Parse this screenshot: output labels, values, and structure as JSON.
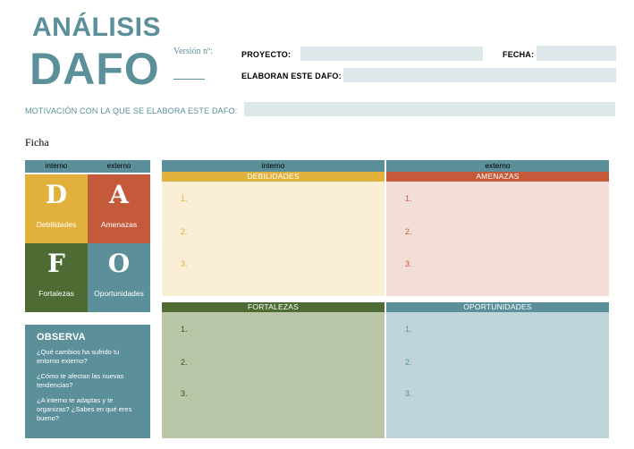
{
  "header": {
    "title_line1": "ANÁLISIS",
    "title_line2": "DAFO",
    "version_label": "Versión nº:"
  },
  "fields": {
    "proyecto_label": "PROYECTO:",
    "fecha_label": "FECHA:",
    "elaboran_label": "ELABORAN ESTE DAFO:",
    "motivacion_label": "MOTIVACIÓN CON LA QUE SE ELABORA ESTE DAFO:"
  },
  "ficha_label": "Ficha",
  "legend": {
    "col_interno": "interno",
    "col_externo": "externo",
    "cells": [
      {
        "letter": "D",
        "name": "Debilidades",
        "color": "#e2b13c"
      },
      {
        "letter": "A",
        "name": "Amenazas",
        "color": "#c55a3b"
      },
      {
        "letter": "F",
        "name": "Fortalezas",
        "color": "#4f6b34"
      },
      {
        "letter": "O",
        "name": "Oportunidades",
        "color": "#5b8f9a"
      }
    ]
  },
  "observa": {
    "title": "OBSERVA",
    "questions": [
      "¿Qué cambios ha sufrido tu entorno externo?",
      "¿Cómo te afectan las nuevas tendencias?",
      "¿A interno te adaptas y te organizas? ¿Sabes en qué eres bueno?"
    ]
  },
  "matrix": {
    "col_interno": "interno",
    "col_externo": "externo",
    "debilidades": {
      "title": "DEBILIDADES",
      "items": [
        "1.",
        "2.",
        "3."
      ],
      "head_color": "#e2b13c",
      "body_color": "#faeed5",
      "num_color": "#e2b13c"
    },
    "amenazas": {
      "title": "AMENAZAS",
      "items": [
        "1.",
        "2.",
        "3."
      ],
      "head_color": "#c55a3b",
      "body_color": "#f2ddd7",
      "num_color": "#c55a3b"
    },
    "fortalezas": {
      "title": "FORTALEZAS",
      "items": [
        "1.",
        "2.",
        "3."
      ],
      "head_color": "#4f6b34",
      "body_color": "#b9c6a7",
      "num_color": "#3d5426"
    },
    "oportunidades": {
      "title": "OPORTUNIDADES",
      "items": [
        "1.",
        "2.",
        "3."
      ],
      "head_color": "#5b8f9a",
      "body_color": "#bfd5d9",
      "num_color": "#5b8f9a"
    }
  }
}
